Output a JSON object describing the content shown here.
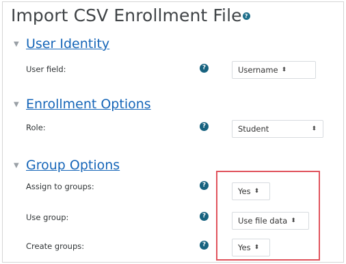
{
  "page": {
    "title": "Import CSV Enrollment File",
    "help_icon_glyph": "?"
  },
  "sections": [
    {
      "heading": "User Identity",
      "fields": [
        {
          "label": "User field:",
          "value": "Username"
        }
      ]
    },
    {
      "heading": "Enrollment Options",
      "fields": [
        {
          "label": "Role:",
          "value": "Student"
        }
      ]
    },
    {
      "heading": "Group Options",
      "fields": [
        {
          "label": "Assign to groups:",
          "value": "Yes"
        },
        {
          "label": "Use group:",
          "value": "Use file data"
        },
        {
          "label": "Create groups:",
          "value": "Yes"
        }
      ]
    }
  ],
  "icons": {
    "collapse": "chevron-down-icon",
    "help": "help-question-icon",
    "select_arrows": "select-arrows-icon"
  },
  "colors": {
    "link": "#1565b8",
    "help_icon": "#17627f",
    "highlight_box": "#e0525b"
  }
}
